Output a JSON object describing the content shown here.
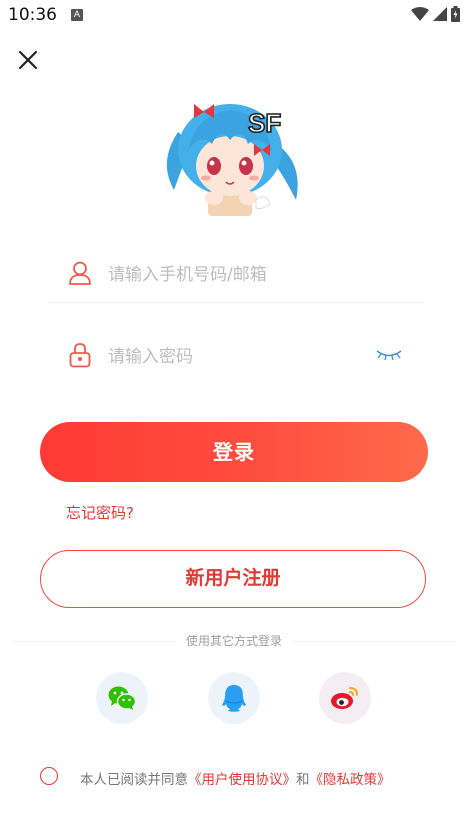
{
  "status_bar": {
    "time": "10:36",
    "notification_icon": "A"
  },
  "login": {
    "account_placeholder": "请输入手机号码/邮箱",
    "password_placeholder": "请输入密码",
    "login_label": "登录",
    "forgot_label": "忘记密码?",
    "register_label": "新用户注册",
    "other_methods_label": "使用其它方式登录",
    "mascot_badge": "SF"
  },
  "social": [
    {
      "name": "wechat",
      "icon": "wechat-icon",
      "color": "#2dc100"
    },
    {
      "name": "qq",
      "icon": "qq-icon",
      "color": "#2a9ef5"
    },
    {
      "name": "weibo",
      "icon": "weibo-icon",
      "color": "#e6162d"
    }
  ],
  "agreement": {
    "prefix": "本人已阅读并同意",
    "user_agreement": "《用户使用协议》",
    "and": "和",
    "privacy_policy": "《隐私政策》"
  },
  "colors": {
    "accent": "#e53935",
    "button_gradient_start": "#ff3a36",
    "button_gradient_end": "#ff6a4c",
    "placeholder": "#bdbdbd"
  }
}
